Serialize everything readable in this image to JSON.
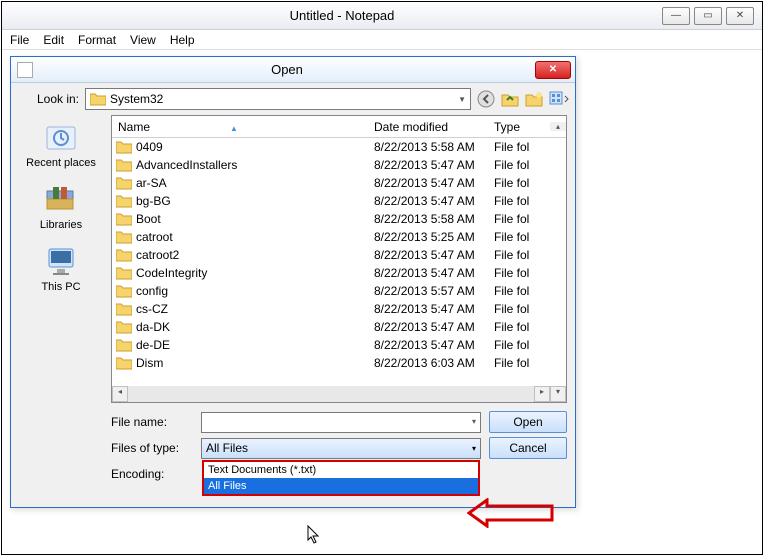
{
  "notepad": {
    "title": "Untitled - Notepad",
    "menus": [
      "File",
      "Edit",
      "Format",
      "View",
      "Help"
    ]
  },
  "dialog": {
    "title": "Open",
    "look_in_label": "Look in:",
    "look_in_value": "System32",
    "columns": {
      "name": "Name",
      "date": "Date modified",
      "type": "Type"
    },
    "places": [
      {
        "label": "Recent places"
      },
      {
        "label": "Libraries"
      },
      {
        "label": "This PC"
      }
    ],
    "rows": [
      {
        "name": "0409",
        "date": "8/22/2013 5:58 AM",
        "type": "File fol"
      },
      {
        "name": "AdvancedInstallers",
        "date": "8/22/2013 5:47 AM",
        "type": "File fol"
      },
      {
        "name": "ar-SA",
        "date": "8/22/2013 5:47 AM",
        "type": "File fol"
      },
      {
        "name": "bg-BG",
        "date": "8/22/2013 5:47 AM",
        "type": "File fol"
      },
      {
        "name": "Boot",
        "date": "8/22/2013 5:58 AM",
        "type": "File fol"
      },
      {
        "name": "catroot",
        "date": "8/22/2013 5:25 AM",
        "type": "File fol"
      },
      {
        "name": "catroot2",
        "date": "8/22/2013 5:47 AM",
        "type": "File fol"
      },
      {
        "name": "CodeIntegrity",
        "date": "8/22/2013 5:47 AM",
        "type": "File fol"
      },
      {
        "name": "config",
        "date": "8/22/2013 5:57 AM",
        "type": "File fol"
      },
      {
        "name": "cs-CZ",
        "date": "8/22/2013 5:47 AM",
        "type": "File fol"
      },
      {
        "name": "da-DK",
        "date": "8/22/2013 5:47 AM",
        "type": "File fol"
      },
      {
        "name": "de-DE",
        "date": "8/22/2013 5:47 AM",
        "type": "File fol"
      },
      {
        "name": "Dism",
        "date": "8/22/2013 6:03 AM",
        "type": "File fol"
      }
    ],
    "file_name_label": "File name:",
    "file_name_value": "",
    "files_of_type_label": "Files of type:",
    "files_of_type_value": "All Files",
    "files_of_type_options": [
      "Text Documents (*.txt)",
      "All Files"
    ],
    "encoding_label": "Encoding:",
    "open_button": "Open",
    "cancel_button": "Cancel"
  }
}
